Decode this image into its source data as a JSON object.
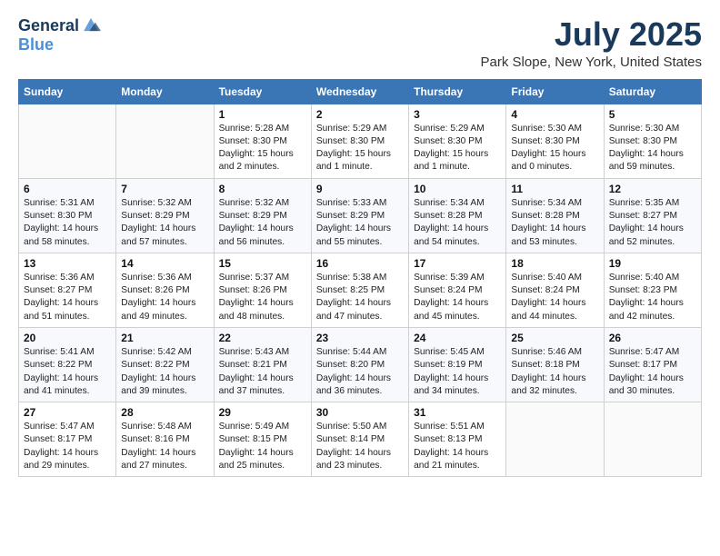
{
  "logo": {
    "line1": "General",
    "line2": "Blue"
  },
  "title": "July 2025",
  "subtitle": "Park Slope, New York, United States",
  "weekdays": [
    "Sunday",
    "Monday",
    "Tuesday",
    "Wednesday",
    "Thursday",
    "Friday",
    "Saturday"
  ],
  "weeks": [
    [
      {
        "day": "",
        "info": ""
      },
      {
        "day": "",
        "info": ""
      },
      {
        "day": "1",
        "info": "Sunrise: 5:28 AM\nSunset: 8:30 PM\nDaylight: 15 hours\nand 2 minutes."
      },
      {
        "day": "2",
        "info": "Sunrise: 5:29 AM\nSunset: 8:30 PM\nDaylight: 15 hours\nand 1 minute."
      },
      {
        "day": "3",
        "info": "Sunrise: 5:29 AM\nSunset: 8:30 PM\nDaylight: 15 hours\nand 1 minute."
      },
      {
        "day": "4",
        "info": "Sunrise: 5:30 AM\nSunset: 8:30 PM\nDaylight: 15 hours\nand 0 minutes."
      },
      {
        "day": "5",
        "info": "Sunrise: 5:30 AM\nSunset: 8:30 PM\nDaylight: 14 hours\nand 59 minutes."
      }
    ],
    [
      {
        "day": "6",
        "info": "Sunrise: 5:31 AM\nSunset: 8:30 PM\nDaylight: 14 hours\nand 58 minutes."
      },
      {
        "day": "7",
        "info": "Sunrise: 5:32 AM\nSunset: 8:29 PM\nDaylight: 14 hours\nand 57 minutes."
      },
      {
        "day": "8",
        "info": "Sunrise: 5:32 AM\nSunset: 8:29 PM\nDaylight: 14 hours\nand 56 minutes."
      },
      {
        "day": "9",
        "info": "Sunrise: 5:33 AM\nSunset: 8:29 PM\nDaylight: 14 hours\nand 55 minutes."
      },
      {
        "day": "10",
        "info": "Sunrise: 5:34 AM\nSunset: 8:28 PM\nDaylight: 14 hours\nand 54 minutes."
      },
      {
        "day": "11",
        "info": "Sunrise: 5:34 AM\nSunset: 8:28 PM\nDaylight: 14 hours\nand 53 minutes."
      },
      {
        "day": "12",
        "info": "Sunrise: 5:35 AM\nSunset: 8:27 PM\nDaylight: 14 hours\nand 52 minutes."
      }
    ],
    [
      {
        "day": "13",
        "info": "Sunrise: 5:36 AM\nSunset: 8:27 PM\nDaylight: 14 hours\nand 51 minutes."
      },
      {
        "day": "14",
        "info": "Sunrise: 5:36 AM\nSunset: 8:26 PM\nDaylight: 14 hours\nand 49 minutes."
      },
      {
        "day": "15",
        "info": "Sunrise: 5:37 AM\nSunset: 8:26 PM\nDaylight: 14 hours\nand 48 minutes."
      },
      {
        "day": "16",
        "info": "Sunrise: 5:38 AM\nSunset: 8:25 PM\nDaylight: 14 hours\nand 47 minutes."
      },
      {
        "day": "17",
        "info": "Sunrise: 5:39 AM\nSunset: 8:24 PM\nDaylight: 14 hours\nand 45 minutes."
      },
      {
        "day": "18",
        "info": "Sunrise: 5:40 AM\nSunset: 8:24 PM\nDaylight: 14 hours\nand 44 minutes."
      },
      {
        "day": "19",
        "info": "Sunrise: 5:40 AM\nSunset: 8:23 PM\nDaylight: 14 hours\nand 42 minutes."
      }
    ],
    [
      {
        "day": "20",
        "info": "Sunrise: 5:41 AM\nSunset: 8:22 PM\nDaylight: 14 hours\nand 41 minutes."
      },
      {
        "day": "21",
        "info": "Sunrise: 5:42 AM\nSunset: 8:22 PM\nDaylight: 14 hours\nand 39 minutes."
      },
      {
        "day": "22",
        "info": "Sunrise: 5:43 AM\nSunset: 8:21 PM\nDaylight: 14 hours\nand 37 minutes."
      },
      {
        "day": "23",
        "info": "Sunrise: 5:44 AM\nSunset: 8:20 PM\nDaylight: 14 hours\nand 36 minutes."
      },
      {
        "day": "24",
        "info": "Sunrise: 5:45 AM\nSunset: 8:19 PM\nDaylight: 14 hours\nand 34 minutes."
      },
      {
        "day": "25",
        "info": "Sunrise: 5:46 AM\nSunset: 8:18 PM\nDaylight: 14 hours\nand 32 minutes."
      },
      {
        "day": "26",
        "info": "Sunrise: 5:47 AM\nSunset: 8:17 PM\nDaylight: 14 hours\nand 30 minutes."
      }
    ],
    [
      {
        "day": "27",
        "info": "Sunrise: 5:47 AM\nSunset: 8:17 PM\nDaylight: 14 hours\nand 29 minutes."
      },
      {
        "day": "28",
        "info": "Sunrise: 5:48 AM\nSunset: 8:16 PM\nDaylight: 14 hours\nand 27 minutes."
      },
      {
        "day": "29",
        "info": "Sunrise: 5:49 AM\nSunset: 8:15 PM\nDaylight: 14 hours\nand 25 minutes."
      },
      {
        "day": "30",
        "info": "Sunrise: 5:50 AM\nSunset: 8:14 PM\nDaylight: 14 hours\nand 23 minutes."
      },
      {
        "day": "31",
        "info": "Sunrise: 5:51 AM\nSunset: 8:13 PM\nDaylight: 14 hours\nand 21 minutes."
      },
      {
        "day": "",
        "info": ""
      },
      {
        "day": "",
        "info": ""
      }
    ]
  ]
}
